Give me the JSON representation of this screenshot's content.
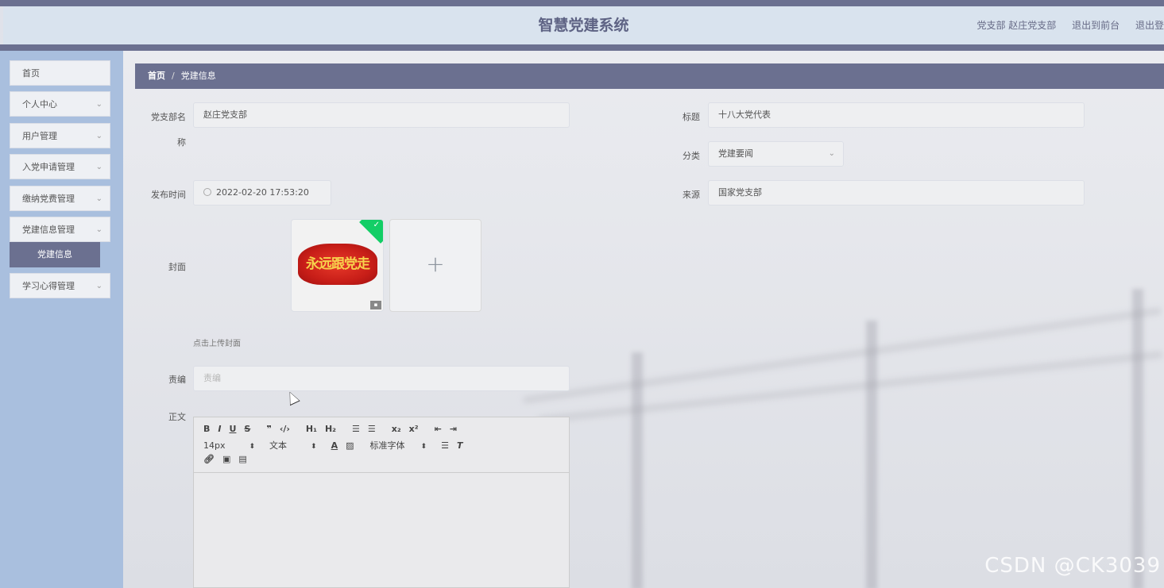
{
  "header": {
    "title": "智慧党建系统",
    "user_label": "党支部 赵庄党支部",
    "front_link": "退出到前台",
    "logout_link": "退出登"
  },
  "sidebar": {
    "items": [
      {
        "label": "首页"
      },
      {
        "label": "个人中心"
      },
      {
        "label": "用户管理"
      },
      {
        "label": "入党申请管理"
      },
      {
        "label": "缴纳党费管理"
      },
      {
        "label": "党建信息管理"
      },
      {
        "label": "学习心得管理"
      }
    ],
    "active_sub": "党建信息"
  },
  "breadcrumb": {
    "home": "首页",
    "sep": "/",
    "current": "党建信息"
  },
  "form": {
    "branch_label_1": "党支部名",
    "branch_label_2": "称",
    "branch_value": "赵庄党支部",
    "title_label": "标题",
    "title_value": "十八大党代表",
    "category_label": "分类",
    "category_value": "党建要闻",
    "time_label": "发布时间",
    "time_value": "2022-02-20 17:53:20",
    "source_label": "来源",
    "source_value": "国家党支部",
    "cover_label": "封面",
    "cover_tip": "点击上传封面",
    "editor_label": "责编",
    "editor_placeholder": "责编",
    "content_label": "正文"
  },
  "cover_image": {
    "text": "永远跟党走"
  },
  "rich_editor": {
    "row1": [
      "B",
      "I",
      "U",
      "S",
      "❞",
      "‹/›",
      "H₁",
      "H₂",
      "☰",
      "☰",
      "x₂",
      "x²",
      "⇤",
      "⇥"
    ],
    "font_size": "14px",
    "block": "文本",
    "font_family": "标准字体"
  },
  "watermark": "CSDN @CK3039",
  "colors": {
    "accent": "#6b7090",
    "sidebar": "#a9bfde",
    "header": "#d9e3ee"
  }
}
